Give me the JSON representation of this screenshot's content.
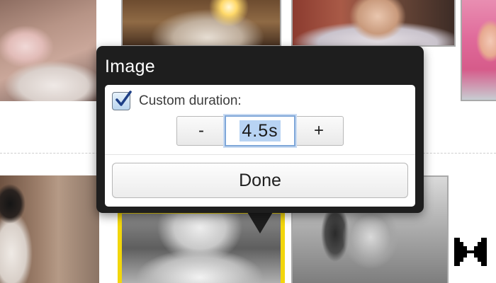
{
  "popover": {
    "title": "Image",
    "custom_duration": {
      "label": "Custom duration:",
      "checked": true
    },
    "stepper": {
      "decrement_label": "-",
      "value": "4.5s",
      "increment_label": "+"
    },
    "done_label": "Done"
  },
  "colors": {
    "popover_background": "#1e1e1e",
    "selected_thumbnail_border": "#f2d60c",
    "text_selection": "#b8d3f3"
  },
  "icons": {
    "checkbox": "check-icon",
    "logo": "bowtie-icon"
  }
}
